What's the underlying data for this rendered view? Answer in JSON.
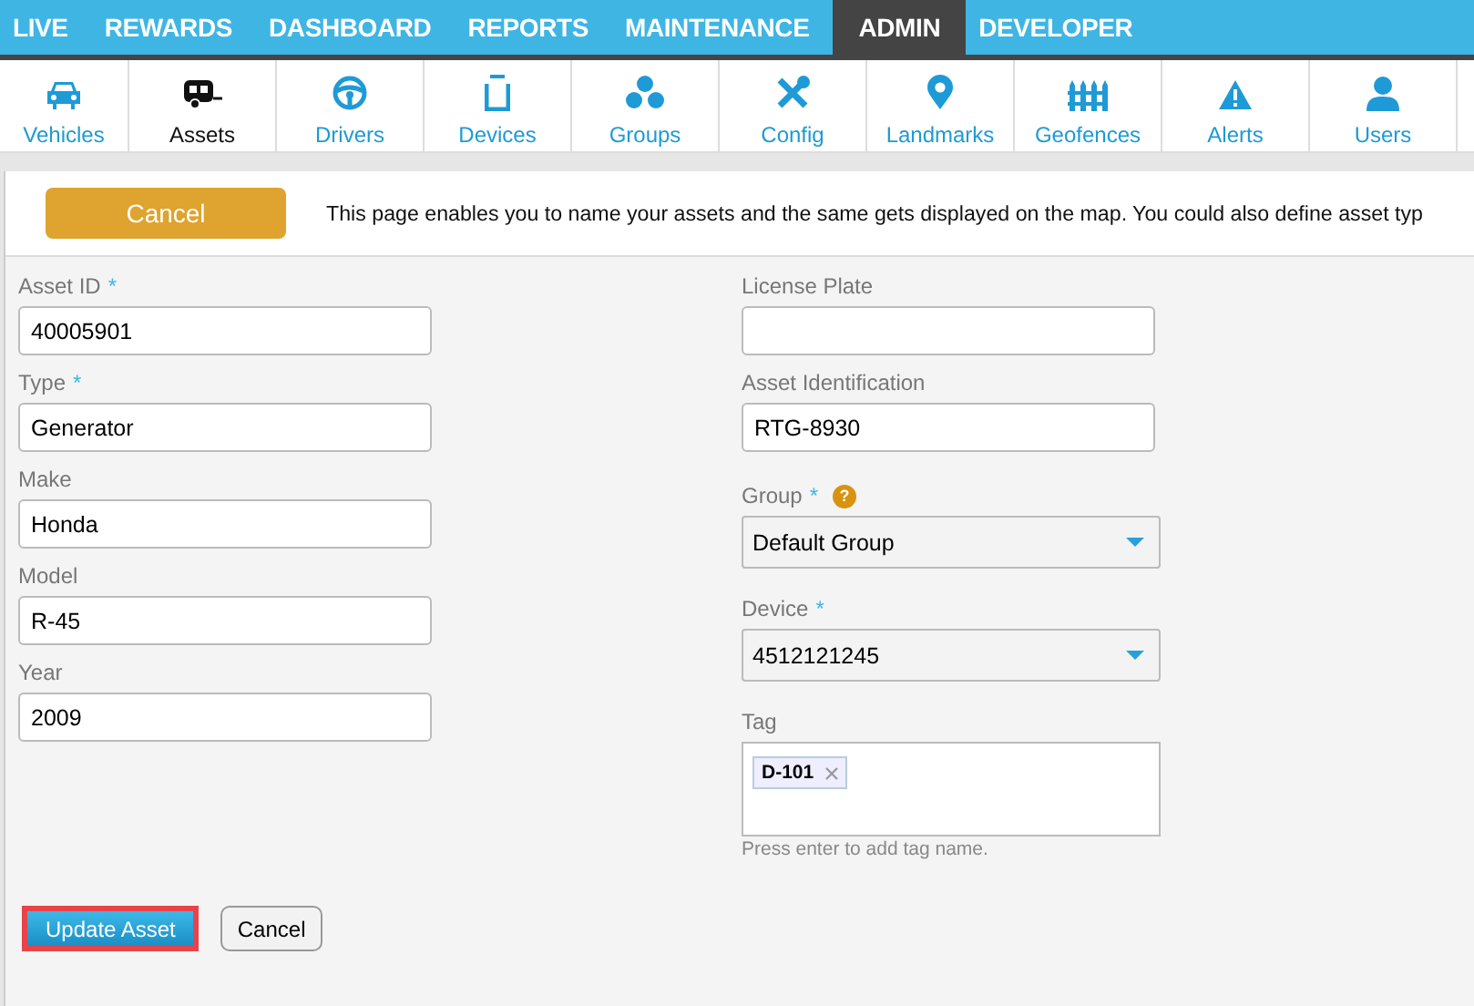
{
  "top_menu": [
    {
      "label": "LIVE",
      "selected": false
    },
    {
      "label": "REWARDS",
      "selected": false
    },
    {
      "label": "DASHBOARD",
      "selected": false
    },
    {
      "label": "REPORTS",
      "selected": false
    },
    {
      "label": "MAINTENANCE",
      "selected": false
    },
    {
      "label": "ADMIN",
      "selected": true
    },
    {
      "label": "DEVELOPER",
      "selected": false
    }
  ],
  "admin_tabs": [
    {
      "label": "Vehicles",
      "selected": false
    },
    {
      "label": "Assets",
      "selected": true
    },
    {
      "label": "Drivers",
      "selected": false
    },
    {
      "label": "Devices",
      "selected": false
    },
    {
      "label": "Groups",
      "selected": false
    },
    {
      "label": "Config",
      "selected": false
    },
    {
      "label": "Landmarks",
      "selected": false
    },
    {
      "label": "Geofences",
      "selected": false
    },
    {
      "label": "Alerts",
      "selected": false
    },
    {
      "label": "Users",
      "selected": false
    }
  ],
  "header": {
    "cancel_button": "Cancel",
    "intro": "This page enables you to name your assets and the same gets displayed on the map. You could also define asset typ"
  },
  "left_fields": [
    {
      "kind": "text",
      "label": "Asset ID",
      "required_mark": "*",
      "value": "40005901"
    },
    {
      "kind": "text",
      "label": "Type",
      "required_mark": "*",
      "value": "Generator"
    },
    {
      "kind": "text",
      "label": "Make",
      "value": "Honda"
    },
    {
      "kind": "text",
      "label": "Model",
      "value": "R-45"
    },
    {
      "kind": "text",
      "label": "Year",
      "value": "2009"
    }
  ],
  "right_fields": [
    {
      "kind": "text",
      "label": "License Plate"
    },
    {
      "kind": "text",
      "label": "Asset Identification",
      "value": "RTG-8930"
    },
    {
      "kind": "select",
      "label": "Group",
      "required_mark": "*",
      "help": "?",
      "value": "Default Group"
    },
    {
      "kind": "select",
      "label": "Device",
      "required_mark": "*",
      "value": "4512121245"
    },
    {
      "kind": "tags",
      "label": "Tag",
      "tags": [
        "D-101"
      ],
      "hint": "Press enter to add tag name."
    }
  ],
  "actions": {
    "update_button": "Update Asset",
    "cancel_button": "Cancel"
  }
}
